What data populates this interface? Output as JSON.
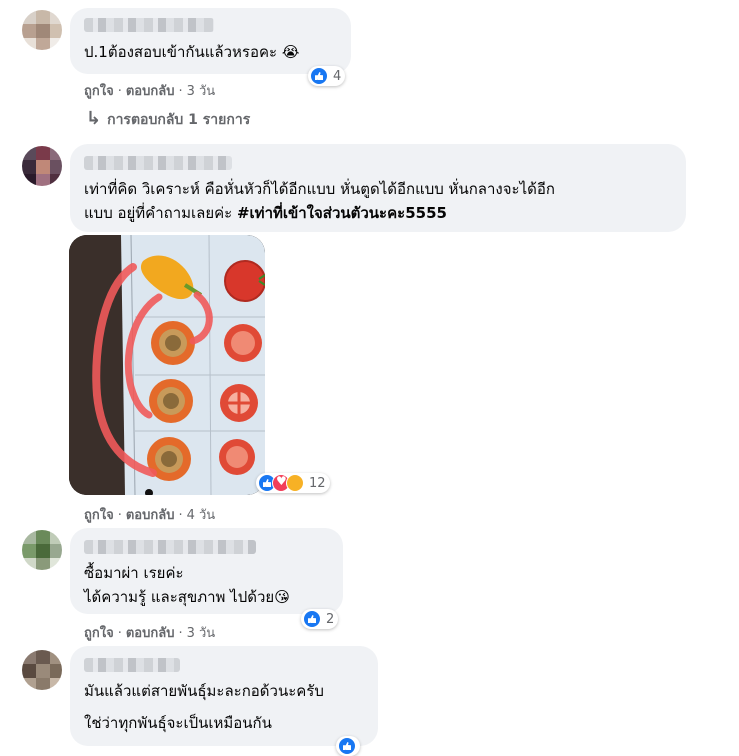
{
  "comments": [
    {
      "text": "ป.1ต้องสอบเข้ากันแล้วหรอคะ 😭",
      "reaction_count": "4",
      "like": "ถูกใจ",
      "reply": "ตอบกลับ",
      "time": "3 วัน",
      "replies_link": "การตอบกลับ 1 รายการ"
    },
    {
      "text_line1": "เท่าที่คิด วิเคราะห์ คือหั่นหัวก็ได้อีกแบบ หั่นตูดได้อีกแบบ หั่นกลางจะได้อีก",
      "text_line2_plain": "แบบ อยู่ที่คำถามเลยค่ะ ",
      "text_line2_tag": "#เท่าที่เข้าใจส่วนตัวนะคะ5555",
      "reaction_count": "12",
      "like": "ถูกใจ",
      "reply": "ตอบกลับ",
      "time": "4 วัน"
    },
    {
      "text_line1": "ซื้อมาผ่า เรยค่ะ",
      "text_line2": "ได้ความรู้ และสุขภาพ ไปด้วย😘",
      "reaction_count": "2",
      "like": "ถูกใจ",
      "reply": "ตอบกลับ",
      "time": "3 วัน"
    },
    {
      "text_line1": "มันแล้วแต่สายพันธุ์มะละกอด้วนะครับ",
      "text_line2": "ใช่ว่าทุกพันธุ์จะเป็นเหมือนกัน"
    }
  ],
  "reply_arrow": "↳",
  "colors": {
    "bubble": "#f0f2f5",
    "like_blue": "#1877f2",
    "love_red": "#f33e58",
    "meta_gray": "#65676b",
    "marker_red": "#f05a5a"
  }
}
